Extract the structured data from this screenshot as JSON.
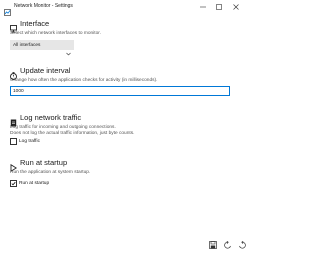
{
  "window": {
    "title": "Network Monitor - Settings",
    "icon": "network-monitor-app-icon"
  },
  "titlebar_buttons": [
    "minimize-icon",
    "maximize-icon",
    "close-icon"
  ],
  "sections": {
    "interface": {
      "icon": "monitor-icon",
      "title": "Interface",
      "description": "Select which network interfaces to monitor.",
      "dropdown_value": "All interfaces"
    },
    "update_interval": {
      "icon": "stopwatch-icon",
      "title": "Update interval",
      "description": "Change how often the application checks for activity (in milliseconds).",
      "input_value": "1000"
    },
    "log_traffic": {
      "icon": "document-icon",
      "title": "Log network traffic",
      "description_line1": "Log traffic for incoming and outgoing connections.",
      "description_line2": "Does not log the actual traffic information, just byte counts.",
      "checkbox_label": "Log traffic",
      "checked": false
    },
    "run_at_startup": {
      "icon": "play-icon",
      "title": "Run at startup",
      "description": "Run the application at system startup.",
      "checkbox_label": "Run at startup",
      "checked": true
    }
  },
  "footer_buttons": [
    "save-icon",
    "undo-icon",
    "reset-icon"
  ],
  "colors": {
    "accent": "#0078d7",
    "combo_bg": "#e6e6e6",
    "text": "#1a1a1a",
    "muted_text": "#555555"
  }
}
